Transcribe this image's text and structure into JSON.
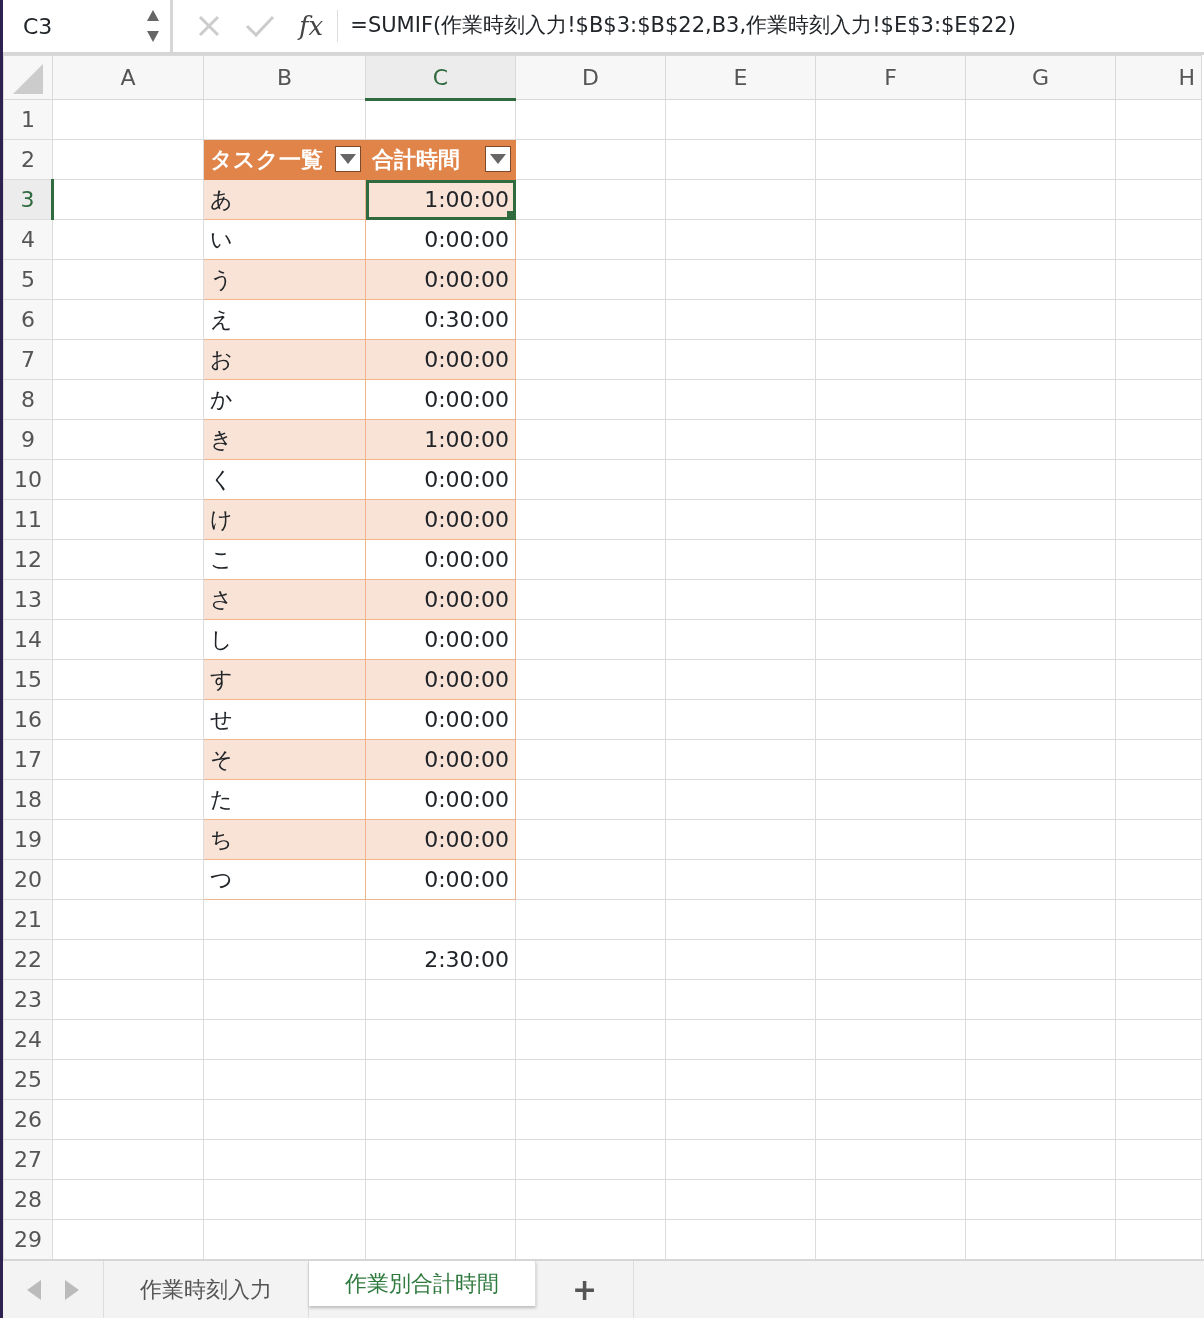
{
  "name_box": "C3",
  "function_label": "fx",
  "formula": "=SUMIF(作業時刻入力!$B$3:$B$22,B3,作業時刻入力!$E$3:$E$22)",
  "columns": [
    {
      "label": "A",
      "selected": false
    },
    {
      "label": "B",
      "selected": false
    },
    {
      "label": "C",
      "selected": true
    },
    {
      "label": "D",
      "selected": false
    },
    {
      "label": "E",
      "selected": false
    },
    {
      "label": "F",
      "selected": false
    },
    {
      "label": "G",
      "selected": false
    },
    {
      "label": "H",
      "selected": false
    }
  ],
  "rows": [
    {
      "label": "1",
      "selected": false
    },
    {
      "label": "2",
      "selected": false
    },
    {
      "label": "3",
      "selected": true
    },
    {
      "label": "4",
      "selected": false
    },
    {
      "label": "5",
      "selected": false
    },
    {
      "label": "6",
      "selected": false
    },
    {
      "label": "7",
      "selected": false
    },
    {
      "label": "8",
      "selected": false
    },
    {
      "label": "9",
      "selected": false
    },
    {
      "label": "10",
      "selected": false
    },
    {
      "label": "11",
      "selected": false
    },
    {
      "label": "12",
      "selected": false
    },
    {
      "label": "13",
      "selected": false
    },
    {
      "label": "14",
      "selected": false
    },
    {
      "label": "15",
      "selected": false
    },
    {
      "label": "16",
      "selected": false
    },
    {
      "label": "17",
      "selected": false
    },
    {
      "label": "18",
      "selected": false
    },
    {
      "label": "19",
      "selected": false
    },
    {
      "label": "20",
      "selected": false
    },
    {
      "label": "21",
      "selected": false
    },
    {
      "label": "22",
      "selected": false
    },
    {
      "label": "23",
      "selected": false
    },
    {
      "label": "24",
      "selected": false
    },
    {
      "label": "25",
      "selected": false
    },
    {
      "label": "26",
      "selected": false
    },
    {
      "label": "27",
      "selected": false
    },
    {
      "label": "28",
      "selected": false
    },
    {
      "label": "29",
      "selected": false
    }
  ],
  "table": {
    "header": [
      "タスク一覧",
      "合計時間"
    ],
    "rows": [
      {
        "task": "あ",
        "total": "1:00:00",
        "selected": true
      },
      {
        "task": "い",
        "total": "0:00:00",
        "selected": false
      },
      {
        "task": "う",
        "total": "0:00:00",
        "selected": false
      },
      {
        "task": "え",
        "total": "0:30:00",
        "selected": false
      },
      {
        "task": "お",
        "total": "0:00:00",
        "selected": false
      },
      {
        "task": "か",
        "total": "0:00:00",
        "selected": false
      },
      {
        "task": "き",
        "total": "1:00:00",
        "selected": false
      },
      {
        "task": "く",
        "total": "0:00:00",
        "selected": false
      },
      {
        "task": "け",
        "total": "0:00:00",
        "selected": false
      },
      {
        "task": "こ",
        "total": "0:00:00",
        "selected": false
      },
      {
        "task": "さ",
        "total": "0:00:00",
        "selected": false
      },
      {
        "task": "し",
        "total": "0:00:00",
        "selected": false
      },
      {
        "task": "す",
        "total": "0:00:00",
        "selected": false
      },
      {
        "task": "せ",
        "total": "0:00:00",
        "selected": false
      },
      {
        "task": "そ",
        "total": "0:00:00",
        "selected": false
      },
      {
        "task": "た",
        "total": "0:00:00",
        "selected": false
      },
      {
        "task": "ち",
        "total": "0:00:00",
        "selected": false
      },
      {
        "task": "つ",
        "total": "0:00:00",
        "selected": false
      }
    ]
  },
  "grand_total": "2:30:00",
  "sheet_tabs": [
    {
      "label": "作業時刻入力",
      "selected": false
    },
    {
      "label": "作業別合計時間",
      "selected": true
    }
  ],
  "add_sheet": "+"
}
